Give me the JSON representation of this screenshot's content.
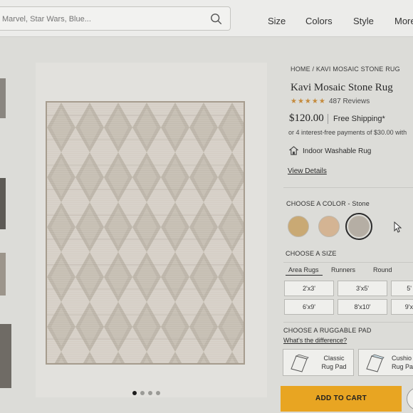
{
  "search": {
    "placeholder": "Marvel, Star Wars, Blue..."
  },
  "nav": {
    "items": [
      "Size",
      "Colors",
      "Style",
      "More"
    ]
  },
  "breadcrumb": {
    "home": "HOME",
    "separator": "/",
    "current": "KAVI MOSAIC STONE RUG"
  },
  "product": {
    "title": "Kavi Mosaic Stone Rug",
    "stars": "★★★★★",
    "rating_value": 4.5,
    "reviews": "487 Reviews",
    "price": "$120.00",
    "shipping": "Free Shipping*",
    "installments": "or 4 interest-free payments of $30.00 with",
    "feature": "Indoor Washable Rug",
    "details_link": "View Details"
  },
  "color": {
    "label": "CHOOSE A COLOR - Stone",
    "swatches": [
      {
        "name": "swatch-1",
        "color": "#c9a974"
      },
      {
        "name": "swatch-2",
        "color": "#d4b493"
      },
      {
        "name": "swatch-3",
        "color": "#b5aea4"
      }
    ],
    "selected_index": 2
  },
  "size": {
    "label": "CHOOSE A SIZE",
    "tabs": [
      "Area Rugs",
      "Runners",
      "Round"
    ],
    "active_tab": 0,
    "options": [
      "2'x3'",
      "3'x5'",
      "5'",
      "6'x9'",
      "8'x10'",
      "9'x"
    ]
  },
  "pad": {
    "label": "CHOOSE A RUGGABLE PAD",
    "help_link": "What's the difference?",
    "options": [
      {
        "line1": "Classic",
        "line2": "Rug Pad"
      },
      {
        "line1": "Cushio",
        "line2": "Rug Pa"
      }
    ]
  },
  "cart": {
    "label": "ADD TO CART"
  },
  "gallery": {
    "dot_count": 4,
    "active_dot": 0
  },
  "colors": {
    "accent": "#e8a522",
    "star": "#c48a3c"
  }
}
